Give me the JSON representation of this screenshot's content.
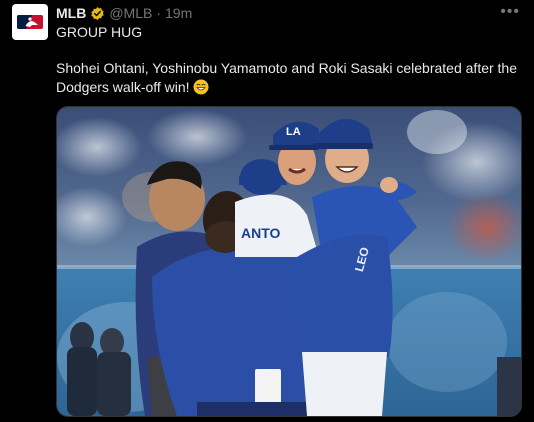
{
  "account": {
    "name": "MLB",
    "handle": "@MLB",
    "separator": "·",
    "time": "19m",
    "verified": true,
    "avatar_icon": "mlb-logo-icon"
  },
  "menu": {
    "more_label": "•••"
  },
  "post": {
    "line1": "GROUP HUG",
    "text": "Shohei Ohtani, Yoshinobu Yamamoto and Roki Sasaki celebrated after the Dodgers walk-off win!",
    "emoji_icon": "grinning-sweat-emoji-icon"
  },
  "media": {
    "jersey_partial_1": "ANTO",
    "jersey_partial_2": "LEO",
    "cap_logo": "LA"
  },
  "colors": {
    "background": "#000000",
    "text": "#e7e9ea",
    "secondary": "#71767b",
    "verified_gold": "#e2b719",
    "dodger_blue": "#1d3f8f"
  }
}
